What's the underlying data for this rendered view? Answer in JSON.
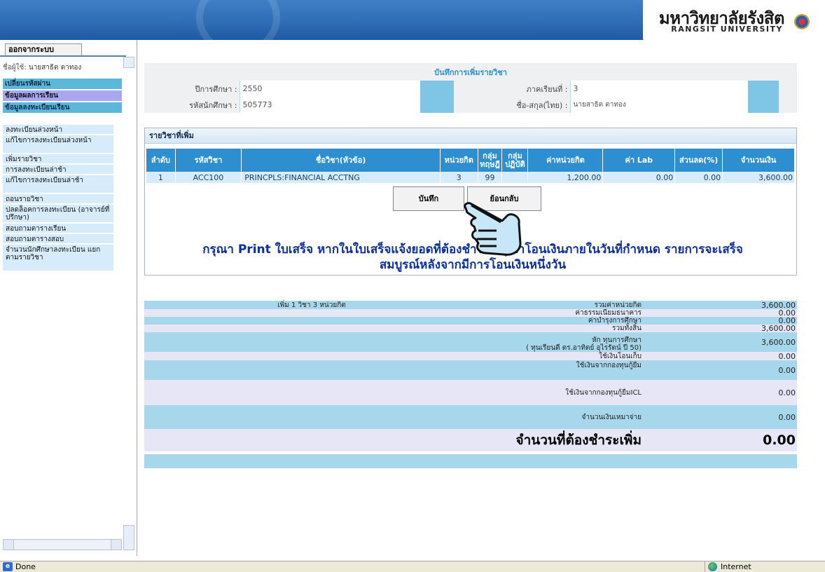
{
  "banner": {
    "university_th": "มหาวิทยาลัยรังสิต",
    "university_en": "RANGSIT UNIVERSITY"
  },
  "sidebar": {
    "logout": "ออกจากระบบ",
    "user_label": "ชื่อผู้ใช้:",
    "user_name": "นายสาธิต ตาทอง",
    "change_password": "เปลี่ยนรหัสผ่าน",
    "grades": "ข้อมูลผลการเรียน",
    "registration": "ข้อมูลลงทะเบียนเรียน",
    "items": [
      "ลงทะเบียนล่วงหน้า",
      "แก้ไขการลงทะเบียนล่วงหน้า",
      "เพิ่มรายวิชา",
      "การลงทะเบียนล่าช้า",
      "แก้ไขการลงทะเบียนล่าช้า",
      "ถอนรายวิชา",
      "ปลดล็อคการลงทะเบียน (อาจารย์ที่ปรึกษา)",
      "สอบถามตารางเรียน",
      "สอบถามตารางสอบ",
      "จำนวนนักศึกษาลงทะเบียน แยกตามรายวิชา"
    ]
  },
  "form": {
    "title": "บันทึกการเพิ่มรายวิชา",
    "year_label": "ปีการศึกษา :",
    "year_value": "2550",
    "term_label": "ภาคเรียนที่ :",
    "term_value": "3",
    "student_id_label": "รหัสนักศึกษา :",
    "student_id_value": "505773",
    "name_label": "ชื่อ-สกุล(ไทย) :",
    "name_value": "นายสาธิต ตาทอง"
  },
  "added": {
    "header": "รายวิชาที่เพิ่ม",
    "columns": [
      "ลำดับ",
      "รหัสวิชา",
      "ชื่อวิชา(หัวข้อ)",
      "หน่วยกิต",
      "กลุ่ม ทฤษฎี",
      "กลุ่ม ปฏิบัติ",
      "ค่าหน่วยกิต",
      "ค่า Lab",
      "ส่วนลด(%)",
      "จำนวนเงิน"
    ],
    "rows": [
      [
        "1",
        "ACC100",
        "PRINCPLS:FINANCIAL ACCTNG",
        "3",
        "99",
        "",
        "1,200.00",
        "0.00",
        "0.00",
        "3,600.00"
      ]
    ],
    "save_button": "บันทึก",
    "back_button": "ย้อนกลับ"
  },
  "notice": {
    "line1": "กรุณา Print ใบเสร็จ หากในใบเสร็จแจ้งยอดที่ต้องชำระ กรุณาโอนเงินภายในวันที่กำหนด รายการจะเสร็จ",
    "line2": "สมบูรณ์หลังจากมีการโอนเงินหนึ่งวัน"
  },
  "summary": {
    "count_text": "เพิ่ม 1 วิชา 3 หน่วยกิต",
    "rows": [
      {
        "label": "รวมค่าหน่วยกิต",
        "amount": "3,600.00"
      },
      {
        "label": "ค่าธรรมเนียมธนาคาร",
        "amount": "0.00"
      },
      {
        "label": "ค่าบำรุงการศึกษา",
        "amount": "0.00"
      },
      {
        "label": "รวมทั้งสิ้น",
        "amount": "3,600.00"
      },
      {
        "label": "หัก ทุนการศึกษา",
        "label2": "( ทุนเรียนดี ดร.อาทิตย์ อุไรรัตน์ ปี 50)",
        "amount": "3,600.00"
      },
      {
        "label": "ใช้เงินโอนเก็บ",
        "amount": "0.00"
      },
      {
        "label": "ใช้เงินจากกองทุนกู้ยืม",
        "amount": "0.00"
      },
      {
        "label": "ใช้เงินจากกองทุนกู้ยืมICL",
        "amount": "0.00"
      },
      {
        "label": "จำนวนเงินเหมาจ่าย",
        "amount": "0.00"
      }
    ],
    "net_label": "จำนวนที่ต้องชำระเพิ่ม",
    "net_amount": "0.00"
  },
  "statusbar": {
    "status": "Done",
    "zone": "Internet"
  }
}
